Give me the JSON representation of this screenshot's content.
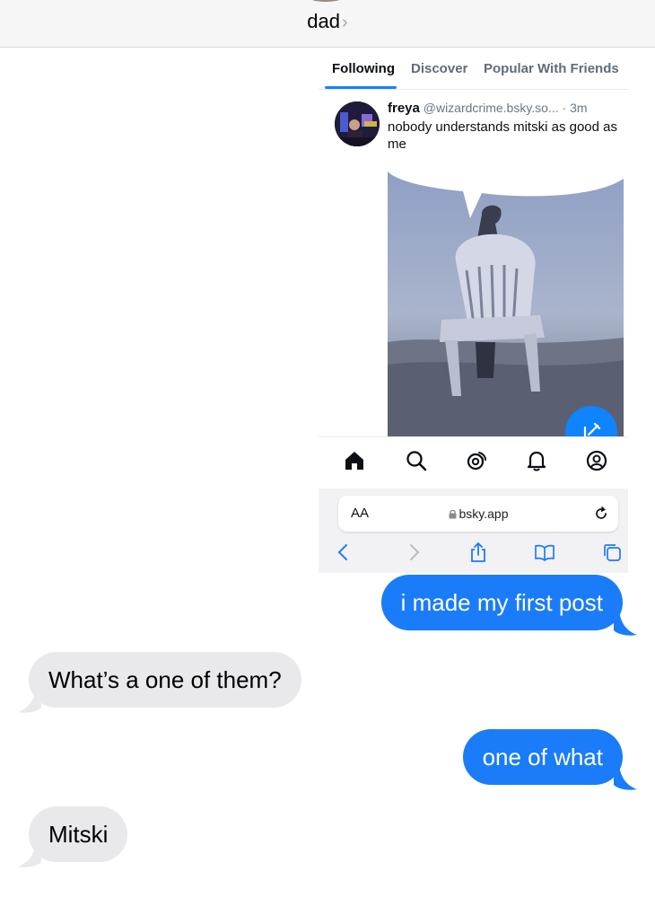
{
  "header": {
    "contact_name": "dad",
    "chevron": "›"
  },
  "screenshot": {
    "tabs": [
      "Following",
      "Discover",
      "Popular With Friends"
    ],
    "post": {
      "author": "freya",
      "handle": "@wizardcrime.bsky.so...",
      "time": "· 3m",
      "text": "nobody understands mitski as good as me"
    },
    "bottom_nav": [
      "home-icon",
      "search-icon",
      "feeds-icon",
      "notifications-icon",
      "profile-icon"
    ],
    "browser": {
      "text_size_label": "AA",
      "url": "bsky.app",
      "toolbar": [
        "back-icon",
        "forward-icon",
        "share-icon",
        "bookmarks-icon",
        "tabs-icon"
      ]
    }
  },
  "messages": [
    {
      "from": "me",
      "text": "i made my first post"
    },
    {
      "from": "them",
      "text": "What’s a one of them?"
    },
    {
      "from": "me",
      "text": "one of what"
    },
    {
      "from": "them",
      "text": "Mitski"
    }
  ],
  "colors": {
    "sent_bubble": "#1a7cf9",
    "received_bubble": "#e9e9eb",
    "accent": "#1083fe"
  }
}
